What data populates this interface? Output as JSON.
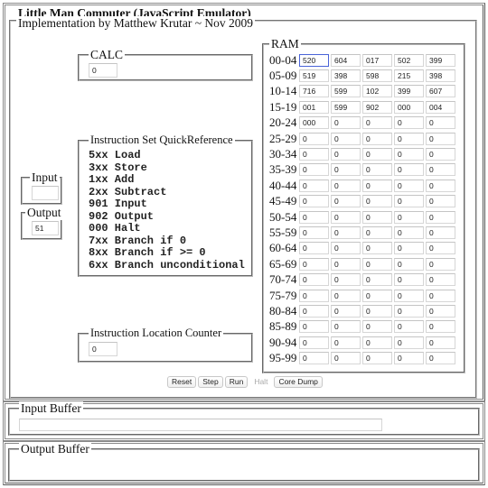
{
  "app": {
    "title": "Little Man Computer (JavaScript Emulator)",
    "subtitle": "Implementation by Matthew Krutar ~ Nov 2009"
  },
  "calc": {
    "legend": "CALC",
    "value": "0"
  },
  "quickref": {
    "legend": "Instruction Set QuickReference",
    "items": [
      "5xx Load",
      "3xx Store",
      "1xx Add",
      "2xx Subtract",
      "901 Input",
      "902 Output",
      "000 Halt",
      "7xx Branch if 0",
      "8xx Branch if >= 0",
      "6xx Branch unconditional"
    ]
  },
  "input": {
    "legend": "Input",
    "value": ""
  },
  "output": {
    "legend": "Output",
    "value": "51"
  },
  "ilc": {
    "legend": "Instruction Location Counter",
    "value": "0"
  },
  "ram": {
    "legend": "RAM",
    "selected_cell": "00",
    "rows": [
      {
        "label": "00-04",
        "cells": [
          "520",
          "604",
          "017",
          "502",
          "399"
        ]
      },
      {
        "label": "05-09",
        "cells": [
          "519",
          "398",
          "598",
          "215",
          "398"
        ]
      },
      {
        "label": "10-14",
        "cells": [
          "716",
          "599",
          "102",
          "399",
          "607"
        ]
      },
      {
        "label": "15-19",
        "cells": [
          "001",
          "599",
          "902",
          "000",
          "004"
        ]
      },
      {
        "label": "20-24",
        "cells": [
          "000",
          "0",
          "0",
          "0",
          "0"
        ]
      },
      {
        "label": "25-29",
        "cells": [
          "0",
          "0",
          "0",
          "0",
          "0"
        ]
      },
      {
        "label": "30-34",
        "cells": [
          "0",
          "0",
          "0",
          "0",
          "0"
        ]
      },
      {
        "label": "35-39",
        "cells": [
          "0",
          "0",
          "0",
          "0",
          "0"
        ]
      },
      {
        "label": "40-44",
        "cells": [
          "0",
          "0",
          "0",
          "0",
          "0"
        ]
      },
      {
        "label": "45-49",
        "cells": [
          "0",
          "0",
          "0",
          "0",
          "0"
        ]
      },
      {
        "label": "50-54",
        "cells": [
          "0",
          "0",
          "0",
          "0",
          "0"
        ]
      },
      {
        "label": "55-59",
        "cells": [
          "0",
          "0",
          "0",
          "0",
          "0"
        ]
      },
      {
        "label": "60-64",
        "cells": [
          "0",
          "0",
          "0",
          "0",
          "0"
        ]
      },
      {
        "label": "65-69",
        "cells": [
          "0",
          "0",
          "0",
          "0",
          "0"
        ]
      },
      {
        "label": "70-74",
        "cells": [
          "0",
          "0",
          "0",
          "0",
          "0"
        ]
      },
      {
        "label": "75-79",
        "cells": [
          "0",
          "0",
          "0",
          "0",
          "0"
        ]
      },
      {
        "label": "80-84",
        "cells": [
          "0",
          "0",
          "0",
          "0",
          "0"
        ]
      },
      {
        "label": "85-89",
        "cells": [
          "0",
          "0",
          "0",
          "0",
          "0"
        ]
      },
      {
        "label": "90-94",
        "cells": [
          "0",
          "0",
          "0",
          "0",
          "0"
        ]
      },
      {
        "label": "95-99",
        "cells": [
          "0",
          "0",
          "0",
          "0",
          "0"
        ]
      }
    ]
  },
  "buttons": [
    {
      "label": "Reset",
      "enabled": true
    },
    {
      "label": "Step",
      "enabled": true
    },
    {
      "label": "Run",
      "enabled": true
    },
    {
      "label": "Halt",
      "enabled": false
    },
    {
      "label": "Core Dump",
      "enabled": true
    }
  ],
  "input_buffer": {
    "legend": "Input Buffer",
    "value": ""
  },
  "output_buffer": {
    "legend": "Output Buffer",
    "value": ""
  }
}
